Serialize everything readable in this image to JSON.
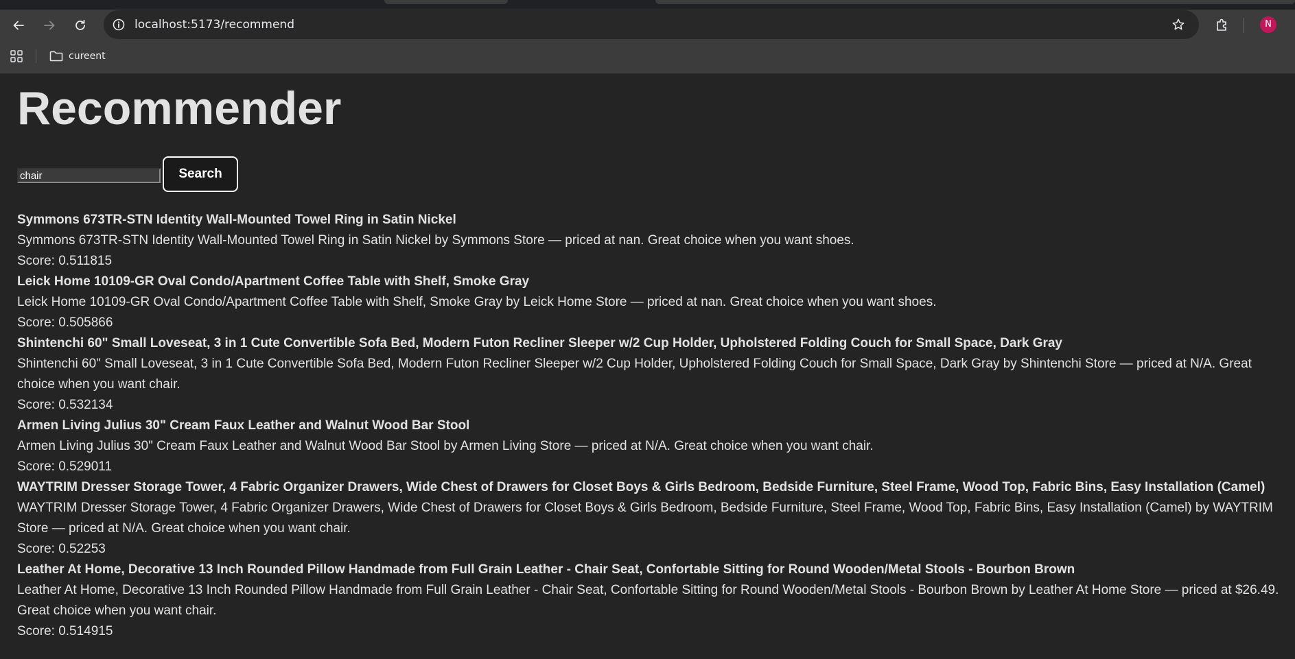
{
  "browser": {
    "url": "localhost:5173/recommend",
    "bookmark_folder": "cureent",
    "profile_initial": "N"
  },
  "page": {
    "title": "Recommender",
    "search": {
      "value": "chair",
      "button_label": "Search"
    },
    "results": [
      {
        "title": "Symmons 673TR-STN Identity Wall-Mounted Towel Ring in Satin Nickel",
        "description": "Symmons 673TR-STN Identity Wall-Mounted Towel Ring in Satin Nickel by Symmons Store — priced at nan. Great choice when you want shoes.",
        "score": "Score: 0.511815"
      },
      {
        "title": "Leick Home 10109-GR Oval Condo/Apartment Coffee Table with Shelf, Smoke Gray",
        "description": "Leick Home 10109-GR Oval Condo/Apartment Coffee Table with Shelf, Smoke Gray by Leick Home Store — priced at nan. Great choice when you want shoes.",
        "score": "Score: 0.505866"
      },
      {
        "title": "Shintenchi 60\" Small Loveseat, 3 in 1 Cute Convertible Sofa Bed, Modern Futon Recliner Sleeper w/2 Cup Holder, Upholstered Folding Couch for Small Space, Dark Gray",
        "description": "Shintenchi 60\" Small Loveseat, 3 in 1 Cute Convertible Sofa Bed, Modern Futon Recliner Sleeper w/2 Cup Holder, Upholstered Folding Couch for Small Space, Dark Gray by Shintenchi Store — priced at N/A. Great choice when you want chair.",
        "score": "Score: 0.532134"
      },
      {
        "title": "Armen Living Julius 30\" Cream Faux Leather and Walnut Wood Bar Stool",
        "description": "Armen Living Julius 30\" Cream Faux Leather and Walnut Wood Bar Stool by Armen Living Store — priced at N/A. Great choice when you want chair.",
        "score": "Score: 0.529011"
      },
      {
        "title": "WAYTRIM Dresser Storage Tower, 4 Fabric Organizer Drawers, Wide Chest of Drawers for Closet Boys & Girls Bedroom, Bedside Furniture, Steel Frame, Wood Top, Fabric Bins, Easy Installation (Camel)",
        "description": "WAYTRIM Dresser Storage Tower, 4 Fabric Organizer Drawers, Wide Chest of Drawers for Closet Boys & Girls Bedroom, Bedside Furniture, Steel Frame, Wood Top, Fabric Bins, Easy Installation (Camel) by WAYTRIM Store — priced at N/A. Great choice when you want chair.",
        "score": "Score: 0.52253"
      },
      {
        "title": "Leather At Home, Decorative 13 Inch Rounded Pillow Handmade from Full Grain Leather - Chair Seat, Confortable Sitting for Round Wooden/Metal Stools - Bourbon Brown",
        "description": "Leather At Home, Decorative 13 Inch Rounded Pillow Handmade from Full Grain Leather - Chair Seat, Confortable Sitting for Round Wooden/Metal Stools - Bourbon Brown by Leather At Home Store — priced at $26.49. Great choice when you want chair.",
        "score": "Score: 0.514915"
      }
    ]
  }
}
